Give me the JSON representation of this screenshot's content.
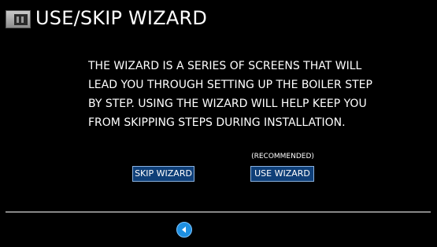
{
  "header": {
    "title": "USE/SKIP WIZARD",
    "icon": "boiler-app-icon"
  },
  "message": {
    "lines": [
      "THE WIZARD IS A SERIES OF SCREENS THAT WILL",
      "LEAD YOU THROUGH SETTING UP THE BOILER STEP",
      "BY STEP. USING THE WIZARD WILL HELP KEEP YOU",
      "FROM SKIPPING STEPS DURING INSTALLATION."
    ]
  },
  "actions": {
    "skip_label": "SKIP WIZARD",
    "use_label": "USE WIZARD",
    "recommended_label": "(RECOMMENDED)"
  },
  "footer": {
    "back_icon": "back-arrow-icon"
  },
  "colors": {
    "background": "#000000",
    "button_fill": "#0f3f78",
    "button_border": "#8ab2e0",
    "back_button": "#1e8fe0"
  }
}
